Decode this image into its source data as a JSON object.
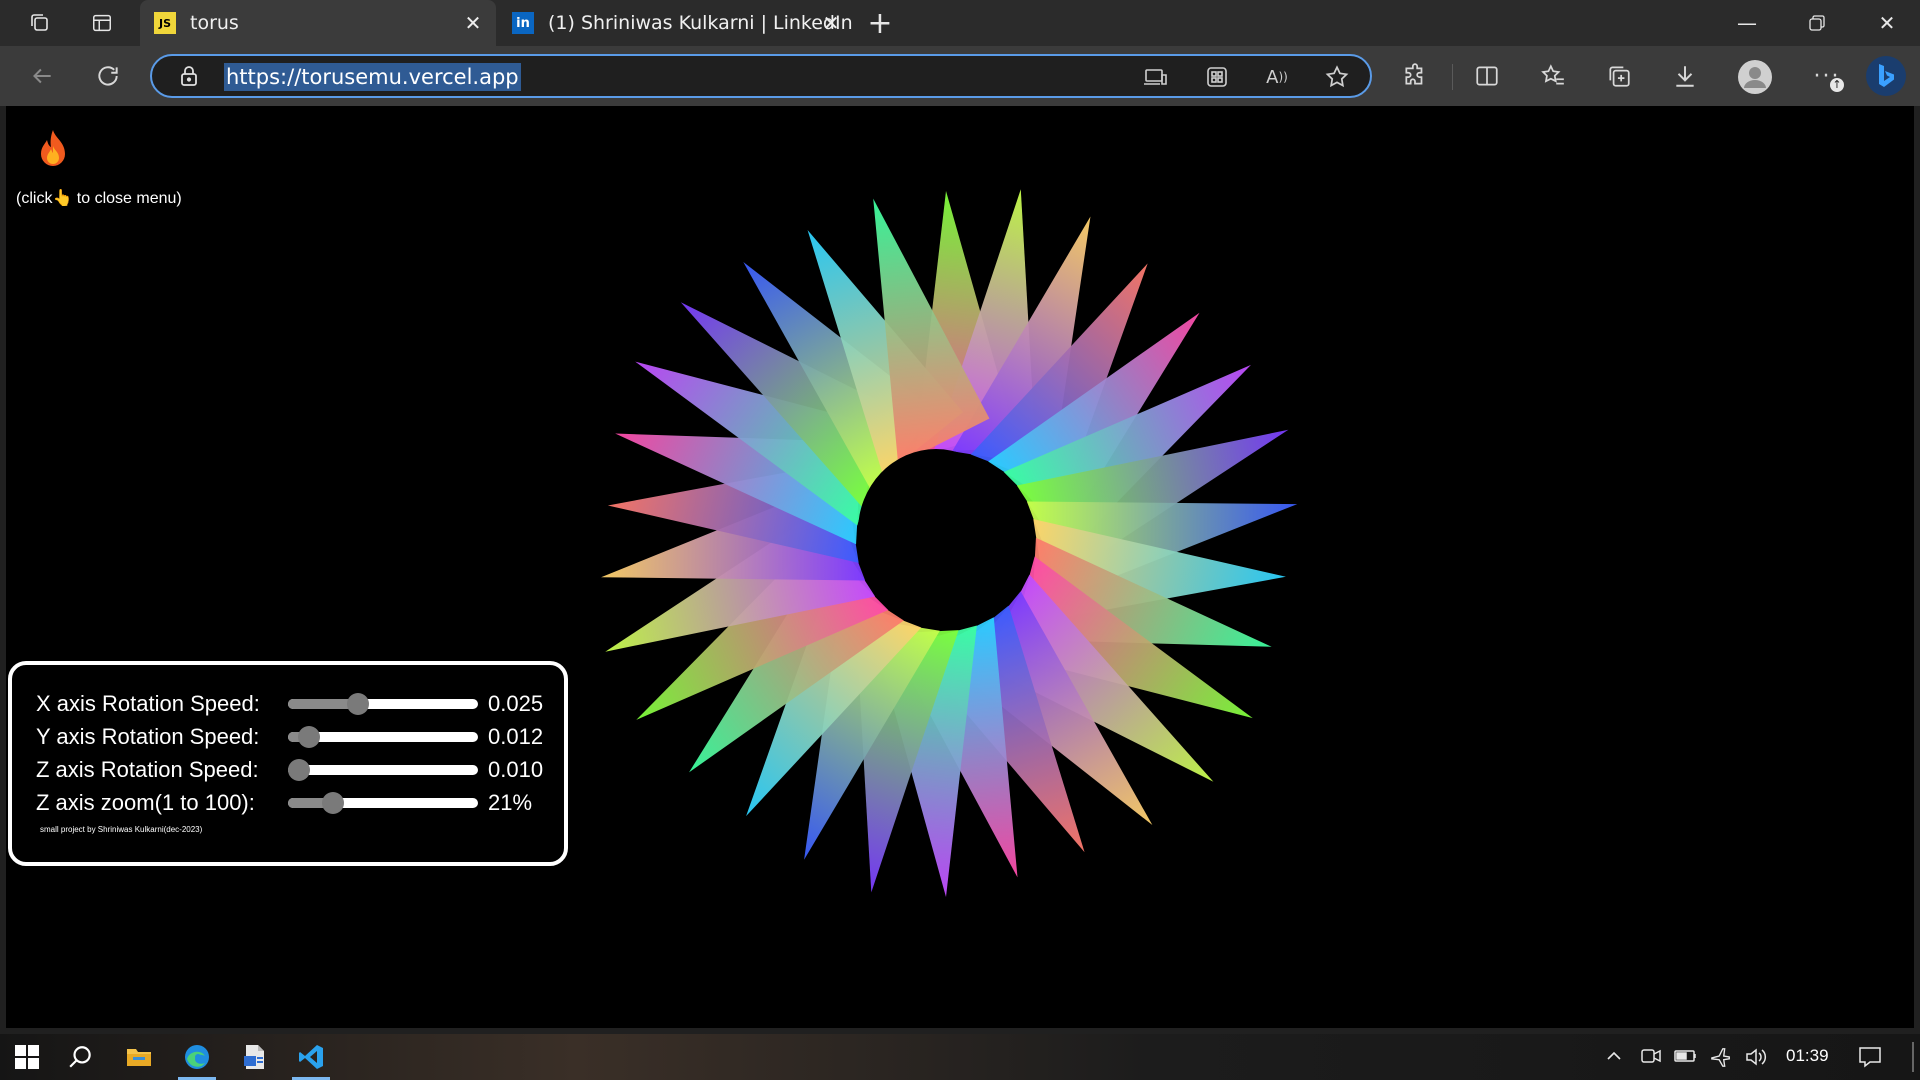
{
  "browser": {
    "tabs": [
      {
        "title": "torus",
        "favicon_text": "JS",
        "favicon_color": "#f0d63a",
        "active": true
      },
      {
        "title": "(1) Shriniwas Kulkarni | LinkedIn",
        "favicon_text": "in",
        "favicon_color": "#0a66c2",
        "active": false
      }
    ],
    "url": "https://torusemu.vercel.app",
    "accent": "#5a9be8"
  },
  "page": {
    "menu_hint": "(click👆 to close menu)",
    "controls": [
      {
        "label": "X axis Rotation Speed:",
        "value": "0.025",
        "level": 0.35
      },
      {
        "label": "Y axis Rotation Speed:",
        "value": "0.012",
        "level": 0.06
      },
      {
        "label": "Z axis Rotation Speed:",
        "value": "0.010",
        "level": 0.0
      },
      {
        "label": "Z axis zoom(1 to 100):",
        "value": "21%",
        "level": 0.2
      }
    ],
    "credit": "small project by Shriniwas Kulkarni(dec-2023)"
  },
  "taskbar": {
    "clock": "01:39"
  }
}
